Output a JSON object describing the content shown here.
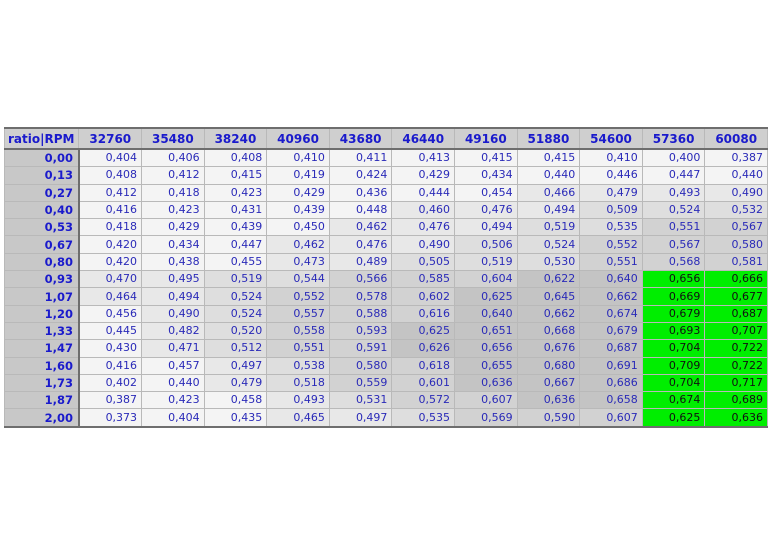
{
  "corner_label": "ratio|RPM",
  "columns": [
    "32760",
    "35480",
    "38240",
    "40960",
    "43680",
    "46440",
    "49160",
    "51880",
    "54600",
    "57360",
    "60080"
  ],
  "rows": [
    {
      "ratio": "0,00",
      "values": [
        "0,404",
        "0,406",
        "0,408",
        "0,410",
        "0,411",
        "0,413",
        "0,415",
        "0,415",
        "0,410",
        "0,400",
        "0,387"
      ]
    },
    {
      "ratio": "0,13",
      "values": [
        "0,408",
        "0,412",
        "0,415",
        "0,419",
        "0,424",
        "0,429",
        "0,434",
        "0,440",
        "0,446",
        "0,447",
        "0,440"
      ]
    },
    {
      "ratio": "0,27",
      "values": [
        "0,412",
        "0,418",
        "0,423",
        "0,429",
        "0,436",
        "0,444",
        "0,454",
        "0,466",
        "0,479",
        "0,493",
        "0,490"
      ]
    },
    {
      "ratio": "0,40",
      "values": [
        "0,416",
        "0,423",
        "0,431",
        "0,439",
        "0,448",
        "0,460",
        "0,476",
        "0,494",
        "0,509",
        "0,524",
        "0,532"
      ]
    },
    {
      "ratio": "0,53",
      "values": [
        "0,418",
        "0,429",
        "0,439",
        "0,450",
        "0,462",
        "0,476",
        "0,494",
        "0,519",
        "0,535",
        "0,551",
        "0,567"
      ]
    },
    {
      "ratio": "0,67",
      "values": [
        "0,420",
        "0,434",
        "0,447",
        "0,462",
        "0,476",
        "0,490",
        "0,506",
        "0,524",
        "0,552",
        "0,567",
        "0,580"
      ]
    },
    {
      "ratio": "0,80",
      "values": [
        "0,420",
        "0,438",
        "0,455",
        "0,473",
        "0,489",
        "0,505",
        "0,519",
        "0,530",
        "0,551",
        "0,568",
        "0,581"
      ]
    },
    {
      "ratio": "0,93",
      "values": [
        "0,470",
        "0,495",
        "0,519",
        "0,544",
        "0,566",
        "0,585",
        "0,604",
        "0,622",
        "0,640",
        "0,656",
        "0,666"
      ]
    },
    {
      "ratio": "1,07",
      "values": [
        "0,464",
        "0,494",
        "0,524",
        "0,552",
        "0,578",
        "0,602",
        "0,625",
        "0,645",
        "0,662",
        "0,669",
        "0,677"
      ]
    },
    {
      "ratio": "1,20",
      "values": [
        "0,456",
        "0,490",
        "0,524",
        "0,557",
        "0,588",
        "0,616",
        "0,640",
        "0,662",
        "0,674",
        "0,679",
        "0,687"
      ]
    },
    {
      "ratio": "1,33",
      "values": [
        "0,445",
        "0,482",
        "0,520",
        "0,558",
        "0,593",
        "0,625",
        "0,651",
        "0,668",
        "0,679",
        "0,693",
        "0,707"
      ]
    },
    {
      "ratio": "1,47",
      "values": [
        "0,430",
        "0,471",
        "0,512",
        "0,551",
        "0,591",
        "0,626",
        "0,656",
        "0,676",
        "0,687",
        "0,704",
        "0,722"
      ]
    },
    {
      "ratio": "1,60",
      "values": [
        "0,416",
        "0,457",
        "0,497",
        "0,538",
        "0,580",
        "0,618",
        "0,655",
        "0,680",
        "0,691",
        "0,709",
        "0,722"
      ]
    },
    {
      "ratio": "1,73",
      "values": [
        "0,402",
        "0,440",
        "0,479",
        "0,518",
        "0,559",
        "0,601",
        "0,636",
        "0,667",
        "0,686",
        "0,704",
        "0,717"
      ]
    },
    {
      "ratio": "1,87",
      "values": [
        "0,387",
        "0,423",
        "0,458",
        "0,493",
        "0,531",
        "0,572",
        "0,607",
        "0,636",
        "0,658",
        "0,674",
        "0,689"
      ]
    },
    {
      "ratio": "2,00",
      "values": [
        "0,373",
        "0,404",
        "0,435",
        "0,465",
        "0,497",
        "0,535",
        "0,569",
        "0,590",
        "0,607",
        "0,625",
        "0,636"
      ]
    }
  ],
  "highlight": {
    "from_row": 7,
    "from_col": 9,
    "color": "#00ee00"
  },
  "colors": {
    "header_text": "#1a1acc",
    "cell_text": "#2a2ab8",
    "header_bg": "#cfcfcf"
  }
}
